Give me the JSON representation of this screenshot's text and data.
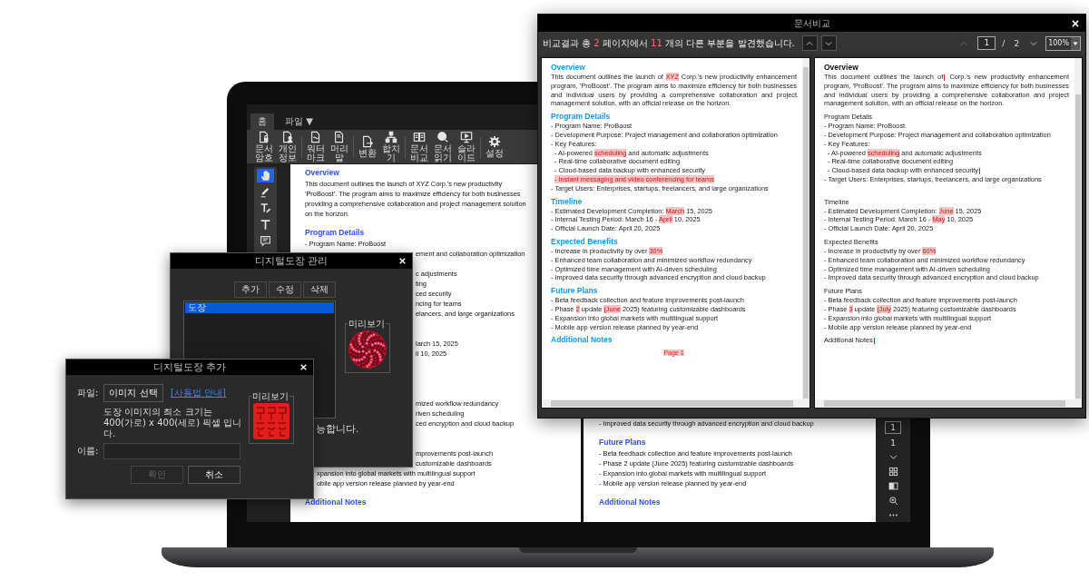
{
  "laptop_app": {
    "tabs": [
      {
        "label": "홈",
        "selected": true
      },
      {
        "label": "파일 ▼",
        "selected": false
      }
    ],
    "toolbar": [
      {
        "label": "문서암호",
        "kind": "lock"
      },
      {
        "label": "개인정보",
        "kind": "person"
      },
      {
        "label": "워터마크",
        "kind": "watermark"
      },
      {
        "label": "머리말",
        "kind": "header"
      },
      {
        "label": "변환",
        "kind": "convert"
      },
      {
        "label": "합치기",
        "kind": "merge"
      },
      {
        "label": "문서비교",
        "kind": "compare"
      },
      {
        "label": "문서 읽기",
        "kind": "read"
      },
      {
        "label": "슬라이드",
        "kind": "slide"
      },
      {
        "label": "설정",
        "kind": "settings"
      }
    ],
    "tools": [
      {
        "kind": "hand",
        "selected": true
      },
      {
        "kind": "pen",
        "selected": false
      },
      {
        "kind": "text-edit",
        "selected": false
      },
      {
        "kind": "text",
        "selected": false
      },
      {
        "kind": "comment",
        "selected": false
      }
    ],
    "page_left": [
      {
        "kind": "heading",
        "text": "Overview"
      },
      {
        "kind": "line",
        "text": "This document outlines the launch of XYZ Corp.'s new productivity"
      },
      {
        "kind": "line",
        "text": "'ProBoost'. The program aims to maximize efficiency for both businesses"
      },
      {
        "kind": "line",
        "text": "providing a comprehensive collaboration and project management solution"
      },
      {
        "kind": "line",
        "text": "on the horizon."
      },
      {
        "kind": "heading",
        "text": "Program Details"
      },
      {
        "kind": "line",
        "text": "- Program Name: ProBoost"
      },
      {
        "kind": "right-of-manager",
        "text": "ement and collaboration optimization"
      },
      {
        "kind": "covered-line"
      },
      {
        "kind": "right-of-manager",
        "text": "c adjustments"
      },
      {
        "kind": "right-of-manager",
        "text": "ting"
      },
      {
        "kind": "right-of-manager",
        "text": "ced security"
      },
      {
        "kind": "right-of-manager",
        "text": "ncing for teams"
      },
      {
        "kind": "right-of-manager",
        "text": "elancers, and large organizations"
      },
      {
        "kind": "covered-heading"
      },
      {
        "kind": "right-of-manager",
        "text": "larch 15, 2025"
      },
      {
        "kind": "right-of-manager",
        "text": "il 10, 2025"
      },
      {
        "kind": "covered-line"
      },
      {
        "kind": "covered-heading"
      },
      {
        "kind": "covered-line"
      },
      {
        "kind": "right-of-manager",
        "text": "mized workflow redundancy"
      },
      {
        "kind": "right-of-manager",
        "text": "riven scheduling"
      },
      {
        "kind": "right-of-manager",
        "text": "ced encryption and cloud backup"
      },
      {
        "kind": "covered-heading"
      },
      {
        "kind": "right-of-manager",
        "text": "mprovements post-launch"
      },
      {
        "kind": "right-of-manager",
        "text": "customizable dashboards"
      },
      {
        "kind": "right-of-add",
        "text": "xpansion into global markets with multilingual support"
      },
      {
        "kind": "right-of-add",
        "text": "obile app version release planned by year-end"
      },
      {
        "kind": "heading",
        "text": "Additional Notes"
      }
    ],
    "page_right": [
      {
        "kind": "line",
        "text": "- Improved data security through advanced encryption and cloud backup"
      },
      {
        "kind": "heading",
        "text": "Future Plans"
      },
      {
        "kind": "line",
        "text": "- Beta feedback collection and feature improvements post-launch"
      },
      {
        "kind": "line",
        "text": "- Phase 2 update (June 2025) featuring customizable dashboards"
      },
      {
        "kind": "line",
        "text": "- Expansion into global markets with multilingual support"
      },
      {
        "kind": "line",
        "text": "- Mobile app version release planned by year-end"
      },
      {
        "kind": "heading",
        "text": "Additional Notes"
      }
    ],
    "side_controls": [
      {
        "kind": "page-input",
        "text": "1"
      },
      {
        "kind": "page-label",
        "text": "1"
      },
      {
        "kind": "next"
      },
      {
        "kind": "grid"
      },
      {
        "kind": "two-page"
      },
      {
        "kind": "zoom"
      },
      {
        "kind": "more"
      }
    ]
  },
  "compare_window": {
    "title": "문서비교",
    "summary": [
      {
        "text": "비교결과 총 ",
        "highlight": false
      },
      {
        "text": "2",
        "highlight": true
      },
      {
        "text": " 페이지에서 ",
        "highlight": false
      },
      {
        "text": "11",
        "highlight": true
      },
      {
        "text": " 개의 다른 부분을 발견했습니다.",
        "highlight": false
      }
    ],
    "page_input": "1",
    "page_separator": "/",
    "page_total": "2",
    "zoom": "100%",
    "panes": [
      {
        "lines": [
          {
            "kind": "heading",
            "text": "Overview"
          },
          {
            "kind": "para",
            "parts": [
              {
                "kind": "same",
                "text": "This document outlines the launch of "
              },
              {
                "kind": "changed",
                "text": "XYZ"
              },
              {
                "kind": "same",
                "text": " Corp.'s new productivity enhancement program, 'ProBoost'. The program aims to maximize efficiency for both businesses and individual users by providing a comprehensive collaboration and project management solution, with an official release on the horizon."
              }
            ]
          },
          {
            "kind": "heading",
            "text": "Program Details"
          },
          {
            "kind": "item",
            "text": "- Program Name: ProBoost"
          },
          {
            "kind": "item",
            "text": "- Development Purpose: Project management and collaboration optimization"
          },
          {
            "kind": "item",
            "text": "- Key Features:"
          },
          {
            "kind": "subitem",
            "parts": [
              {
                "kind": "same",
                "text": "- AI-powered "
              },
              {
                "kind": "changed",
                "text": "scheduling"
              },
              {
                "kind": "same",
                "text": " and automatic adjustments"
              }
            ]
          },
          {
            "kind": "subitem",
            "text": "- Real-time collaborative document editing"
          },
          {
            "kind": "subitem",
            "text": "- Cloud-based data backup with enhanced security"
          },
          {
            "kind": "subitem",
            "parts": [
              {
                "kind": "changed",
                "text": "- Instant messaging and video conferencing for teams"
              }
            ]
          },
          {
            "kind": "item",
            "text": "- Target Users: Enterprises, startups, freelancers, and large organizations"
          },
          {
            "kind": "heading",
            "text": "Timeline"
          },
          {
            "kind": "item",
            "parts": [
              {
                "kind": "same",
                "text": "- Estimated Development Completion: "
              },
              {
                "kind": "changed",
                "text": "March"
              },
              {
                "kind": "same",
                "text": " 15, 2025"
              }
            ]
          },
          {
            "kind": "item",
            "parts": [
              {
                "kind": "same",
                "text": "- Internal Testing Period: March 16 - "
              },
              {
                "kind": "changed",
                "text": "April"
              },
              {
                "kind": "same",
                "text": " 10, 2025"
              }
            ]
          },
          {
            "kind": "item",
            "text": "- Official Launch Date: April 20, 2025"
          },
          {
            "kind": "heading",
            "text": "Expected Benefits"
          },
          {
            "kind": "item",
            "parts": [
              {
                "kind": "same",
                "text": "- Increase in productivity by over "
              },
              {
                "kind": "changed",
                "text": "30%"
              }
            ]
          },
          {
            "kind": "item",
            "text": "- Enhanced team collaboration and minimized workflow redundancy"
          },
          {
            "kind": "item",
            "text": "- Optimized time management with AI-driven scheduling"
          },
          {
            "kind": "item",
            "text": "- Improved data security through advanced encryption and cloud backup"
          },
          {
            "kind": "heading",
            "text": "Future Plans"
          },
          {
            "kind": "item",
            "text": "- Beta feedback collection and feature improvements post-launch"
          },
          {
            "kind": "item",
            "parts": [
              {
                "kind": "same",
                "text": "- Phase "
              },
              {
                "kind": "changed",
                "text": "2"
              },
              {
                "kind": "same",
                "text": " update "
              },
              {
                "kind": "changed",
                "text": "(June"
              },
              {
                "kind": "same",
                "text": " 2025) featuring customizable dashboards"
              }
            ]
          },
          {
            "kind": "item",
            "text": "- Expansion into global markets with multilingual support"
          },
          {
            "kind": "item",
            "text": "- Mobile app version release planned by year-end"
          },
          {
            "kind": "heading",
            "text": "Additional Notes"
          },
          {
            "kind": "footer",
            "text": "Page 1"
          }
        ]
      },
      {
        "lines": [
          {
            "kind": "title",
            "text": "Overview"
          },
          {
            "kind": "para",
            "parts": [
              {
                "kind": "same",
                "text": "This document outlines the launch of"
              },
              {
                "kind": "insert"
              },
              {
                "kind": "same",
                "text": " Corp.'s new productivity enhancement program, 'ProBoost'. The program aims to maximize efficiency for both businesses and individual users by providing a comprehensive collaboration and project management solution, with an official release on the horizon."
              }
            ]
          },
          {
            "kind": "plain-heading",
            "text": "Program Details"
          },
          {
            "kind": "item",
            "text": "- Program Name: ProBoost"
          },
          {
            "kind": "item",
            "text": "- Development Purpose: Project management and collaboration optimization"
          },
          {
            "kind": "item",
            "text": "- Key Features:"
          },
          {
            "kind": "subitem",
            "parts": [
              {
                "kind": "same",
                "text": "- AI-powered "
              },
              {
                "kind": "changed",
                "text": "scheduling"
              },
              {
                "kind": "same",
                "text": " and automatic adjustments"
              }
            ]
          },
          {
            "kind": "subitem",
            "text": "- Real-time collaborative document editing"
          },
          {
            "kind": "subitem",
            "parts": [
              {
                "kind": "same",
                "text": "- Cloud-based data backup with enhanced security"
              },
              {
                "kind": "insert"
              }
            ]
          },
          {
            "kind": "item",
            "text": "- Target Users: Enterprises, startups, freelancers, and large organizations"
          },
          {
            "kind": "blank"
          },
          {
            "kind": "plain-heading",
            "text": "Timeline"
          },
          {
            "kind": "item",
            "parts": [
              {
                "kind": "same",
                "text": "- Estimated Development Completion: "
              },
              {
                "kind": "changed",
                "text": "June"
              },
              {
                "kind": "same",
                "text": " 15, 2025"
              }
            ]
          },
          {
            "kind": "item",
            "parts": [
              {
                "kind": "same",
                "text": "- Internal Testing Period: March 16 - "
              },
              {
                "kind": "changed",
                "text": "May"
              },
              {
                "kind": "same",
                "text": " 10, 2025"
              }
            ]
          },
          {
            "kind": "item",
            "text": "- Official Launch Date: April 20, 2025"
          },
          {
            "kind": "plain-heading",
            "text": "Expected Benefits"
          },
          {
            "kind": "item",
            "parts": [
              {
                "kind": "same",
                "text": "- Increase in productivity by over "
              },
              {
                "kind": "changed",
                "text": "60%"
              }
            ]
          },
          {
            "kind": "item",
            "text": "- Enhanced team collaboration and minimized workflow redundancy"
          },
          {
            "kind": "item",
            "text": "- Optimized time management with AI-driven scheduling"
          },
          {
            "kind": "item",
            "text": "- Improved data security through advanced encryption and cloud backup"
          },
          {
            "kind": "plain-heading",
            "text": "Future Plans"
          },
          {
            "kind": "item",
            "text": "- Beta feedback collection and feature improvements post-launch"
          },
          {
            "kind": "item",
            "parts": [
              {
                "kind": "same",
                "text": "- Phase "
              },
              {
                "kind": "changed",
                "text": "3"
              },
              {
                "kind": "same",
                "text": " update "
              },
              {
                "kind": "changed",
                "text": "(July"
              },
              {
                "kind": "same",
                "text": " 2025) featuring customizable dashboards"
              }
            ]
          },
          {
            "kind": "item",
            "text": "- Expansion into global markets with multilingual support"
          },
          {
            "kind": "item",
            "text": "- Mobile app version release planned by year-end"
          },
          {
            "kind": "plain-heading",
            "parts": [
              {
                "kind": "same",
                "text": "Additional Notes"
              },
              {
                "kind": "insert"
              }
            ]
          }
        ]
      }
    ]
  },
  "stamp_manager": {
    "title": "디지털도장 관리",
    "buttons": [
      "추가",
      "수정",
      "삭제"
    ],
    "stamps": [
      {
        "label": "도장",
        "selected": true
      }
    ],
    "preview_label": "미리보기",
    "note": "능합니다."
  },
  "stamp_add": {
    "title": "디지털도장 추가",
    "file_label": "파일:",
    "choose_button": "이미지 선택",
    "help_link": "[사용법 안내]",
    "description": "도장 이미지의 최소 크기는 400(가로) x 400(세로) 픽셀 입니다.",
    "name_label": "이름:",
    "preview_label": "미리보기",
    "buttons": [
      {
        "label": "확인",
        "disabled": true
      },
      {
        "label": "취소",
        "disabled": false
      }
    ]
  }
}
